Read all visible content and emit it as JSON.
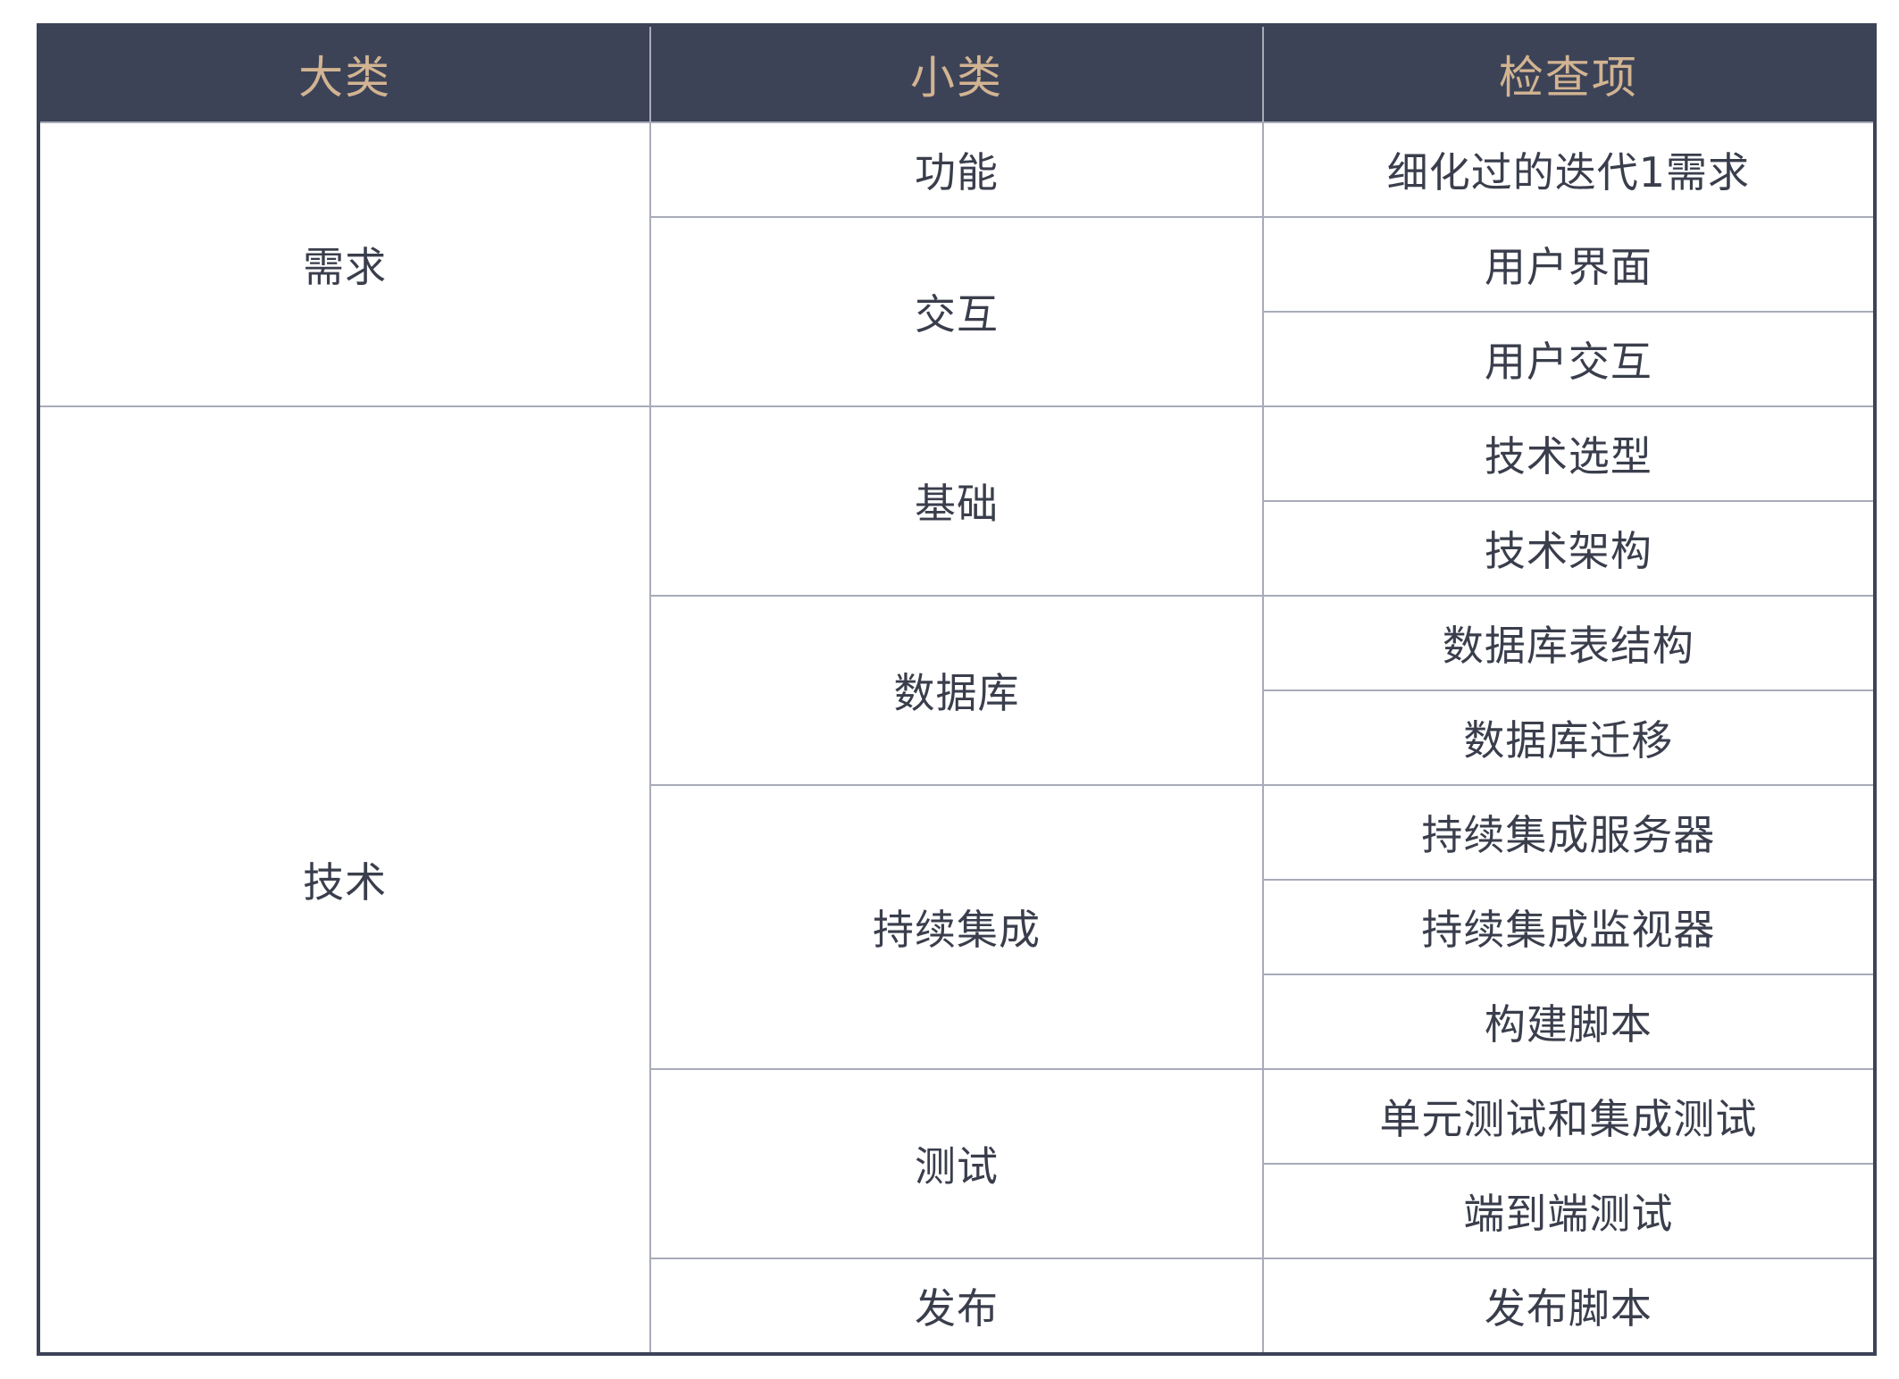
{
  "header": {
    "col1": "大类",
    "col2": "小类",
    "col3": "检查项"
  },
  "categories": [
    {
      "name": "需求",
      "subcategories": [
        {
          "name": "功能",
          "items": [
            "细化过的迭代1需求"
          ]
        },
        {
          "name": "交互",
          "items": [
            "用户界面",
            "用户交互"
          ]
        }
      ]
    },
    {
      "name": "技术",
      "subcategories": [
        {
          "name": "基础",
          "items": [
            "技术选型",
            "技术架构"
          ]
        },
        {
          "name": "数据库",
          "items": [
            "数据库表结构",
            "数据库迁移"
          ]
        },
        {
          "name": "持续集成",
          "items": [
            "持续集成服务器",
            "持续集成监视器",
            "构建脚本"
          ]
        },
        {
          "name": "测试",
          "items": [
            "单元测试和集成测试",
            "端到端测试"
          ]
        },
        {
          "name": "发布",
          "items": [
            "发布脚本"
          ]
        }
      ]
    }
  ],
  "colors": {
    "header_bg": "#3d4357",
    "header_text": "#d2b492",
    "body_text": "#3a3e4c",
    "grid_line": "#a8abb8"
  }
}
